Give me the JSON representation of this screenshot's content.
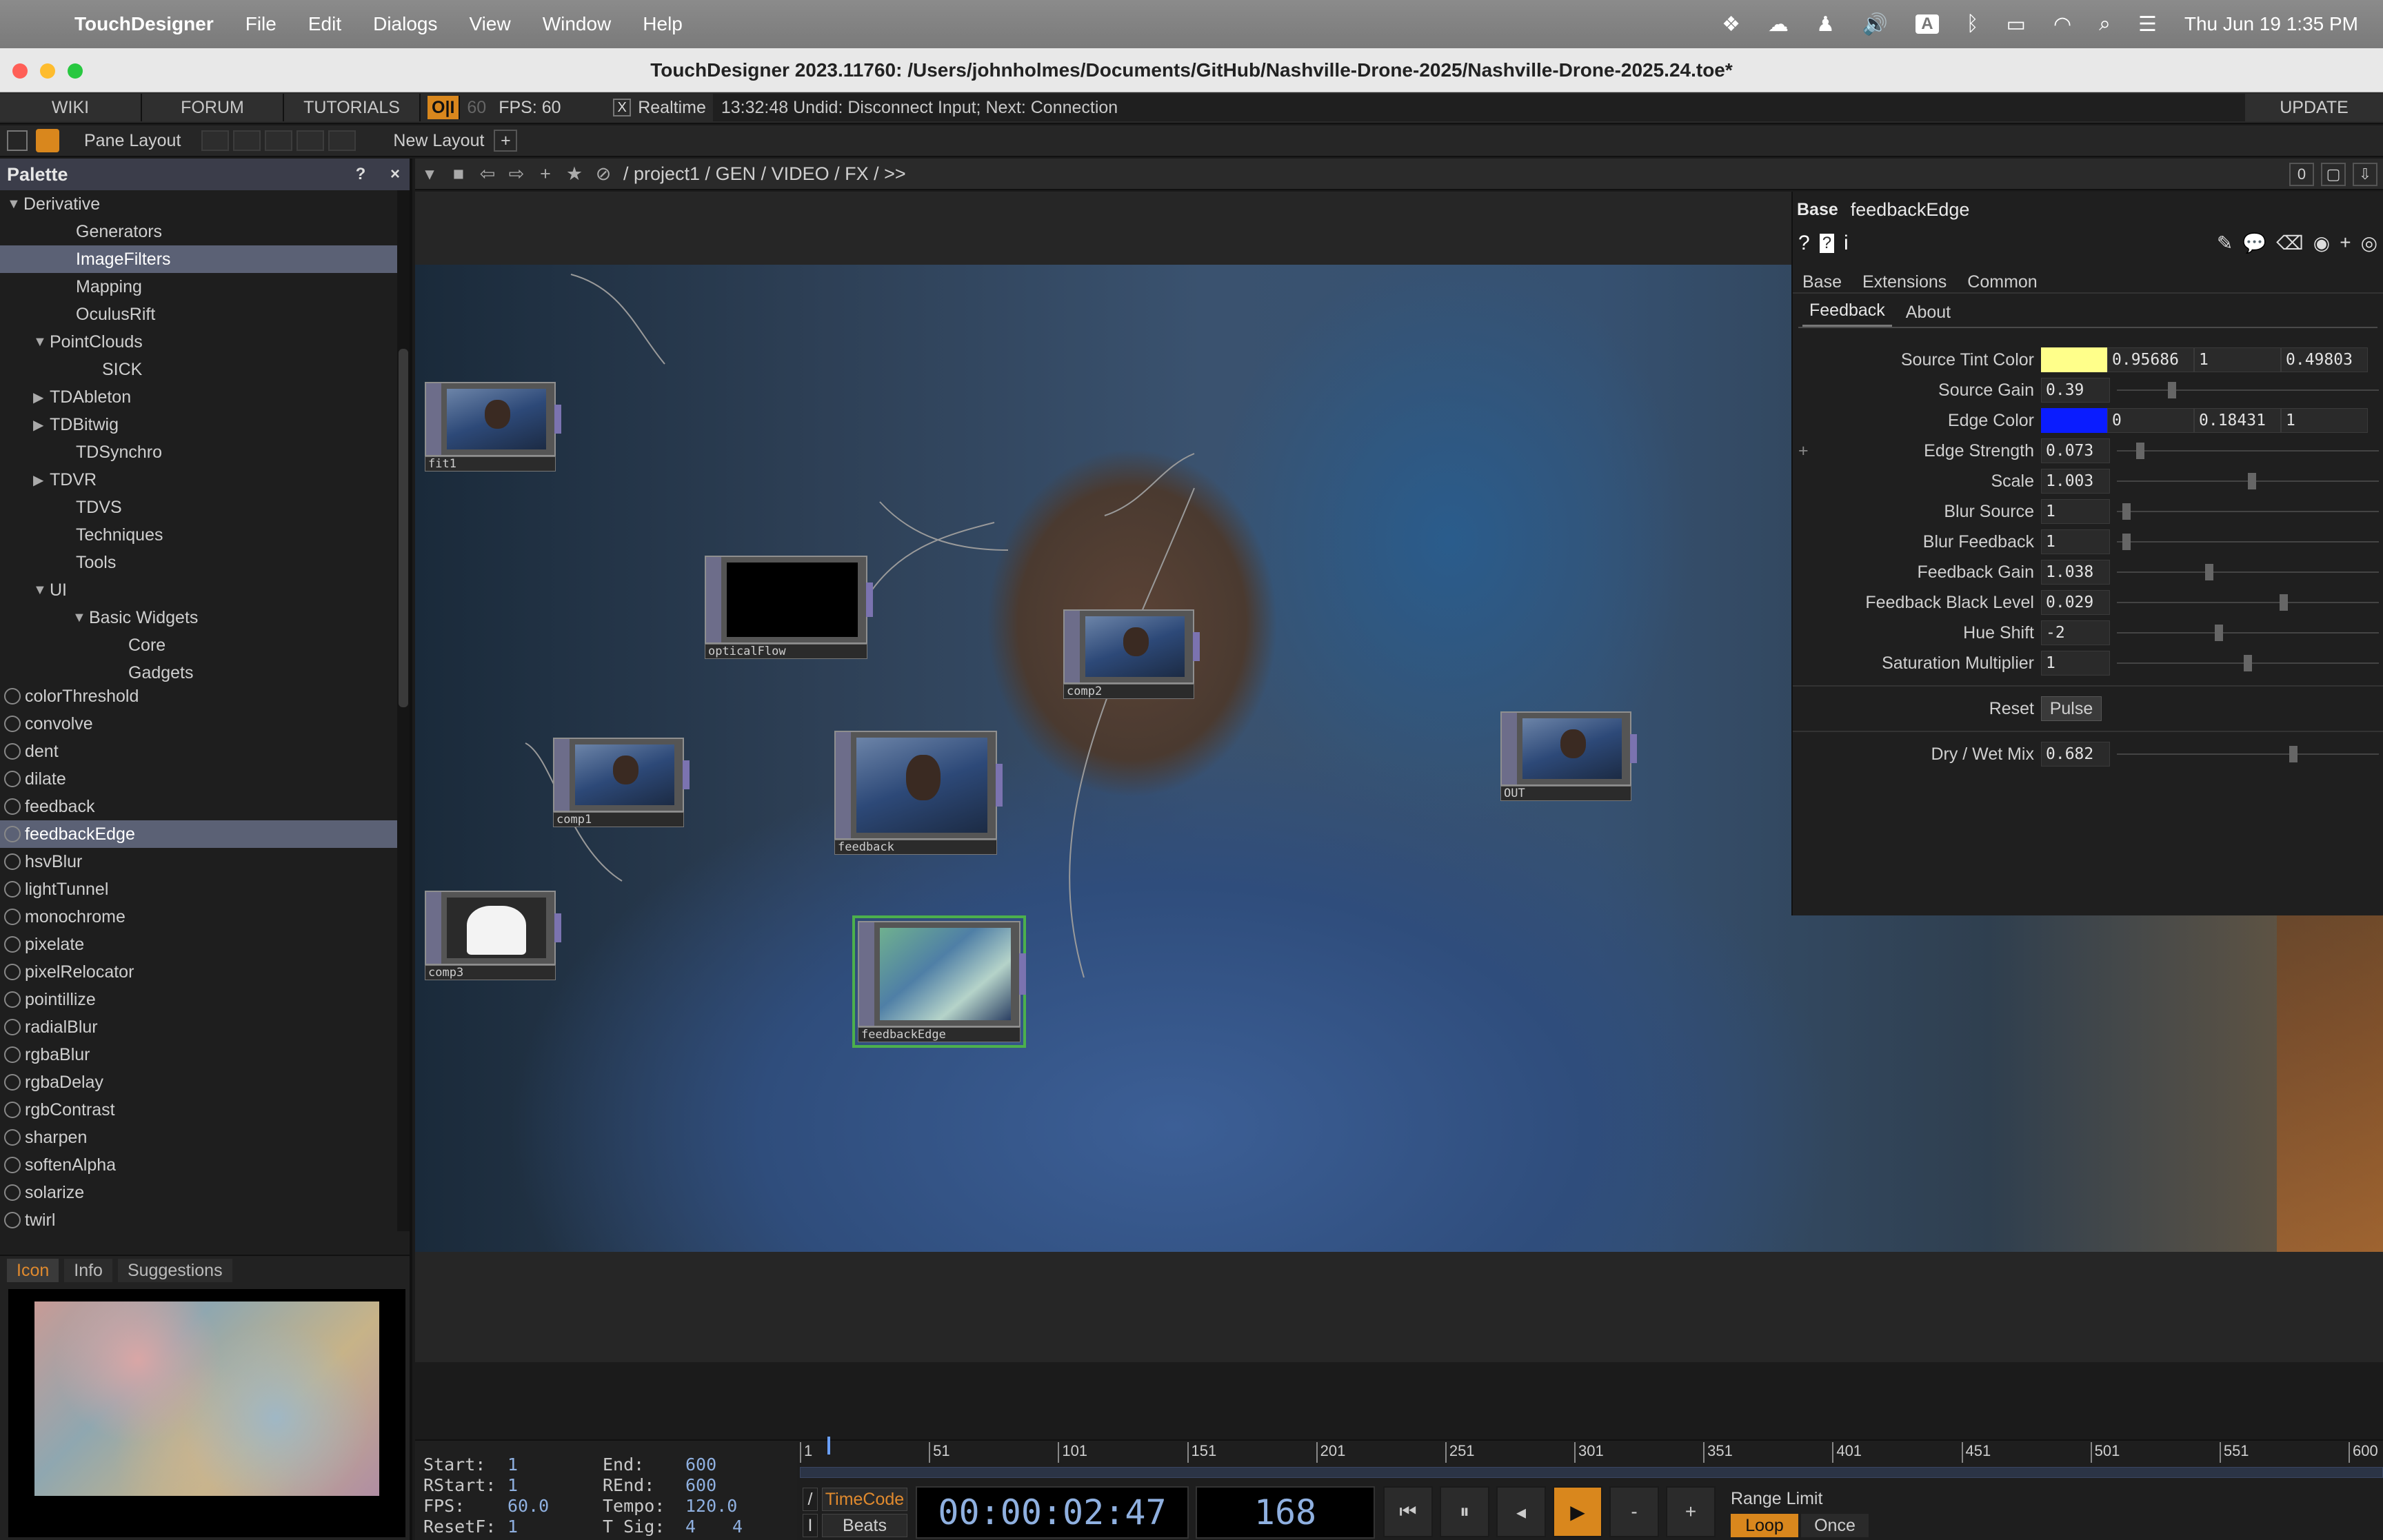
{
  "menubar": {
    "app": "TouchDesigner",
    "items": [
      "File",
      "Edit",
      "Dialogs",
      "View",
      "Window",
      "Help"
    ],
    "input_badge": "A",
    "clock": "Thu Jun 19  1:35 PM"
  },
  "window": {
    "title": "TouchDesigner 2023.11760: /Users/johnholmes/Documents/GitHub/Nashville-Drone-2025/Nashville-Drone-2025.24.toe*"
  },
  "toolbar": {
    "wiki": "WIKI",
    "forum": "FORUM",
    "tutorials": "TUTORIALS",
    "oi": "O|I",
    "fps_dim": "60",
    "fps": "FPS:  60",
    "realtime": "Realtime",
    "realtime_check": "X",
    "status": "13:32:48 Undid: Disconnect Input; Next: Connection",
    "update": "UPDATE"
  },
  "panebar": {
    "pane_layout": "Pane Layout",
    "new_layout": "New Layout",
    "plus": "+"
  },
  "palette": {
    "title": "Palette",
    "help": "?",
    "close": "×",
    "tree": [
      {
        "label": "Derivative",
        "indent": 0,
        "arrow": "down",
        "selected": false
      },
      {
        "label": "Generators",
        "indent": 2,
        "arrow": "",
        "selected": false
      },
      {
        "label": "ImageFilters",
        "indent": 2,
        "arrow": "",
        "selected": true
      },
      {
        "label": "Mapping",
        "indent": 2,
        "arrow": "",
        "selected": false
      },
      {
        "label": "OculusRift",
        "indent": 2,
        "arrow": "",
        "selected": false
      },
      {
        "label": "PointClouds",
        "indent": 1,
        "arrow": "down",
        "selected": false
      },
      {
        "label": "SICK",
        "indent": 3,
        "arrow": "",
        "selected": false
      },
      {
        "label": "TDAbleton",
        "indent": 1,
        "arrow": "right",
        "selected": false
      },
      {
        "label": "TDBitwig",
        "indent": 1,
        "arrow": "right",
        "selected": false
      },
      {
        "label": "TDSynchro",
        "indent": 2,
        "arrow": "",
        "selected": false
      },
      {
        "label": "TDVR",
        "indent": 1,
        "arrow": "right",
        "selected": false
      },
      {
        "label": "TDVS",
        "indent": 2,
        "arrow": "",
        "selected": false
      },
      {
        "label": "Techniques",
        "indent": 2,
        "arrow": "",
        "selected": false
      },
      {
        "label": "Tools",
        "indent": 2,
        "arrow": "",
        "selected": false
      },
      {
        "label": "UI",
        "indent": 1,
        "arrow": "down",
        "selected": false
      },
      {
        "label": "Basic Widgets",
        "indent": 2.5,
        "arrow": "down",
        "selected": false
      },
      {
        "label": "Core",
        "indent": 4,
        "arrow": "",
        "selected": false
      },
      {
        "label": "Gadgets",
        "indent": 4,
        "arrow": "",
        "selected": false
      }
    ],
    "items": [
      {
        "label": "colorThreshold",
        "selected": false
      },
      {
        "label": "convolve",
        "selected": false
      },
      {
        "label": "dent",
        "selected": false
      },
      {
        "label": "dilate",
        "selected": false
      },
      {
        "label": "feedback",
        "selected": false
      },
      {
        "label": "feedbackEdge",
        "selected": true
      },
      {
        "label": "hsvBlur",
        "selected": false
      },
      {
        "label": "lightTunnel",
        "selected": false
      },
      {
        "label": "monochrome",
        "selected": false
      },
      {
        "label": "pixelate",
        "selected": false
      },
      {
        "label": "pixelRelocator",
        "selected": false
      },
      {
        "label": "pointillize",
        "selected": false
      },
      {
        "label": "radialBlur",
        "selected": false
      },
      {
        "label": "rgbaBlur",
        "selected": false
      },
      {
        "label": "rgbaDelay",
        "selected": false
      },
      {
        "label": "rgbContrast",
        "selected": false
      },
      {
        "label": "sharpen",
        "selected": false
      },
      {
        "label": "softenAlpha",
        "selected": false
      },
      {
        "label": "solarize",
        "selected": false
      },
      {
        "label": "twirl",
        "selected": false
      }
    ],
    "preview_tabs": {
      "icon": "Icon",
      "info": "Info",
      "suggestions": "Suggestions"
    }
  },
  "network": {
    "path": "/ project1 / GEN / VIDEO / FX / >>",
    "counter": "0",
    "nodes": {
      "fit1": "fit1",
      "opticalflow": "opticalFlow",
      "comp1": "comp1",
      "feedback": "feedback",
      "comp2": "comp2",
      "comp3": "comp3",
      "feedbackedge": "feedbackEdge",
      "out": "OUT"
    }
  },
  "params": {
    "type": "Base",
    "name": "feedbackEdge",
    "tabs": [
      "Base",
      "Extensions",
      "Common"
    ],
    "subtabs": [
      "Feedback",
      "About"
    ],
    "source_tint": {
      "label": "Source Tint Color",
      "color": "#ffff8a",
      "g": "0.95686",
      "b": "1",
      "a": "0.49803"
    },
    "edge_color": {
      "label": "Edge Color",
      "color": "#0a1cff",
      "r": "0",
      "g": "0.18431",
      "b": "1"
    },
    "rows": {
      "source_gain": {
        "label": "Source Gain",
        "value": "0.39"
      },
      "edge_strength": {
        "label": "Edge Strength",
        "value": "0.073"
      },
      "scale": {
        "label": "Scale",
        "value": "1.003"
      },
      "blur_source": {
        "label": "Blur Source",
        "value": "1"
      },
      "blur_feedback": {
        "label": "Blur Feedback",
        "value": "1"
      },
      "feedback_gain": {
        "label": "Feedback Gain",
        "value": "1.038"
      },
      "feedback_black": {
        "label": "Feedback Black Level",
        "value": "0.029"
      },
      "hue_shift": {
        "label": "Hue Shift",
        "value": "-2"
      },
      "sat_mult": {
        "label": "Saturation Multiplier",
        "value": "1"
      },
      "dry_wet": {
        "label": "Dry / Wet Mix",
        "value": "0.682"
      }
    },
    "reset": {
      "label": "Reset",
      "button": "Pulse"
    },
    "edge_plus": "+"
  },
  "timeline": {
    "start_label": "Start:",
    "start": "1",
    "end_label": "End:",
    "end": "600",
    "rstart_label": "RStart:",
    "rstart": "1",
    "rend_label": "REnd:",
    "rend": "600",
    "fps_label": "FPS:",
    "fps": "60.0",
    "tempo_label": "Tempo:",
    "tempo": "120.0",
    "resetf_label": "ResetF:",
    "resetf": "1",
    "tsig_label": "T Sig:",
    "tsig_a": "4",
    "tsig_b": "4",
    "ruler": [
      "1",
      "51",
      "101",
      "151",
      "201",
      "251",
      "301",
      "351",
      "401",
      "451",
      "501",
      "551",
      "600"
    ],
    "timecode_btn": "TimeCode",
    "beats_btn": "Beats",
    "slash": "/",
    "bar": "I",
    "clock": "00:00:02:47",
    "frame": "168",
    "minus": "-",
    "plus": "+",
    "range_limit": "Range Limit",
    "loop": "Loop",
    "once": "Once"
  }
}
